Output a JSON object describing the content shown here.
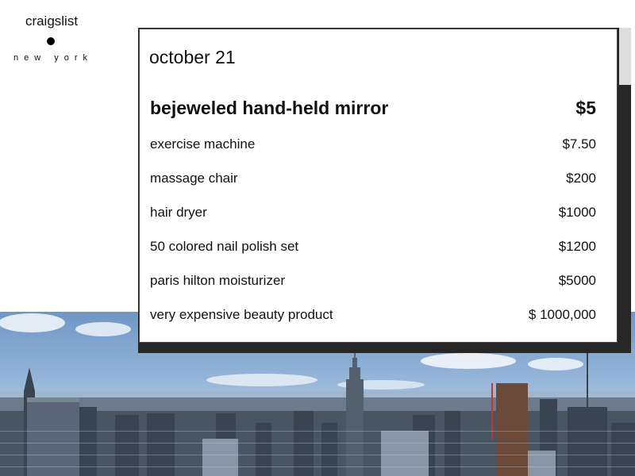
{
  "brand": {
    "name": "craigslist",
    "city": "new york"
  },
  "listing_page": {
    "date": "october 21",
    "items": [
      {
        "title": "bejeweled hand-held mirror",
        "price": "$5",
        "featured": true
      },
      {
        "title": "exercise machine",
        "price": "$7.50"
      },
      {
        "title": "massage chair",
        "price": "$200"
      },
      {
        "title": "hair dryer",
        "price": "$1000"
      },
      {
        "title": "50 colored nail polish set",
        "price": "$1200"
      },
      {
        "title": "paris hilton moisturizer",
        "price": "$5000"
      },
      {
        "title": "very expensive beauty product",
        "price": "$ 1000,000"
      }
    ]
  },
  "scrollbar": {
    "position": 0
  },
  "background": {
    "image": "new-york-skyline-photo"
  }
}
